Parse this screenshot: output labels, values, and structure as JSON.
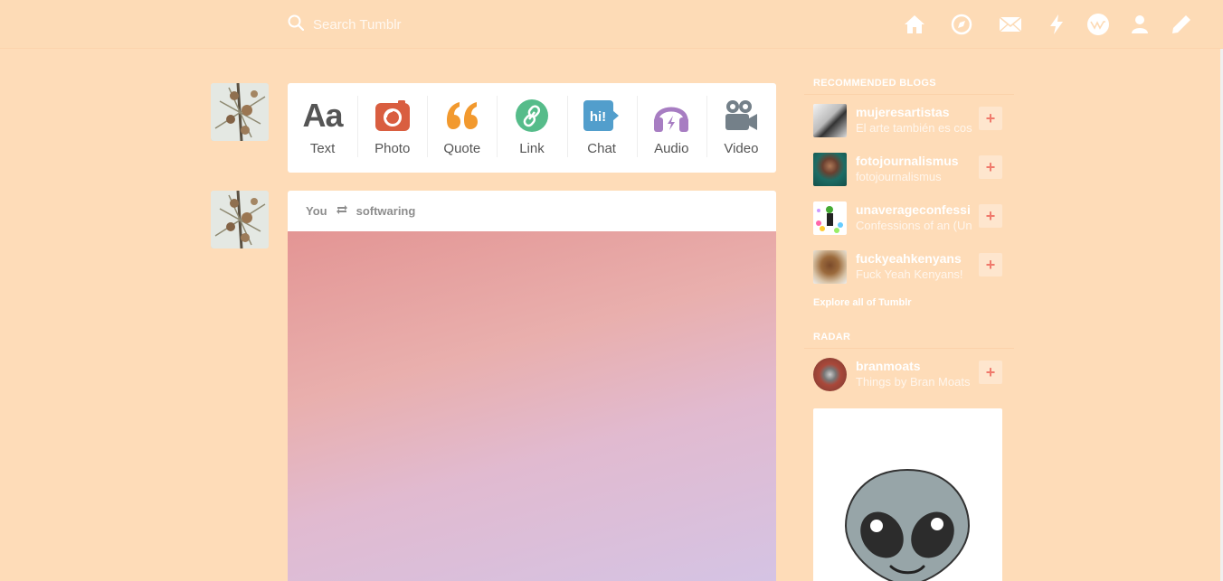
{
  "header": {
    "search_placeholder": "Search Tumblr",
    "icons": [
      "home-icon",
      "explore-icon",
      "inbox-icon",
      "activity-icon",
      "blogs-icon",
      "account-icon",
      "compose-icon"
    ]
  },
  "post_types": [
    {
      "label": "Text",
      "icon": "text-icon",
      "color": "#555555"
    },
    {
      "label": "Photo",
      "icon": "camera-icon",
      "color": "#d95e40"
    },
    {
      "label": "Quote",
      "icon": "quote-icon",
      "color": "#f2992e"
    },
    {
      "label": "Link",
      "icon": "link-icon",
      "color": "#56bc8a"
    },
    {
      "label": "Chat",
      "icon": "chat-icon",
      "color": "#529ecc"
    },
    {
      "label": "Audio",
      "icon": "headphones-icon",
      "color": "#a77dc2"
    },
    {
      "label": "Video",
      "icon": "video-camera-icon",
      "color": "#748089"
    }
  ],
  "post": {
    "author": "You",
    "reblogged_from": "softwaring"
  },
  "sidebar": {
    "recommended_title": "RECOMMENDED BLOGS",
    "blogs": [
      {
        "name": "mujeresartistas",
        "desc": "El arte también es cos",
        "avatar_color": "#444444"
      },
      {
        "name": "fotojournalismus",
        "desc": "fotojournalismus",
        "avatar_color": "#1d6c64"
      },
      {
        "name": "unaverageconfessi",
        "desc": "Confessions of an (Un",
        "avatar_color": "#e8e2f2"
      },
      {
        "name": "fuckyeahkenyans",
        "desc": "Fuck Yeah Kenyans!",
        "avatar_color": "#9b6a3c"
      }
    ],
    "explore_label": "Explore all of Tumblr",
    "radar_title": "RADAR",
    "radar_blog": {
      "name": "branmoats",
      "desc": "Things by Bran Moats",
      "avatar_color": "#7a3a30"
    },
    "follow_symbol": "+"
  }
}
